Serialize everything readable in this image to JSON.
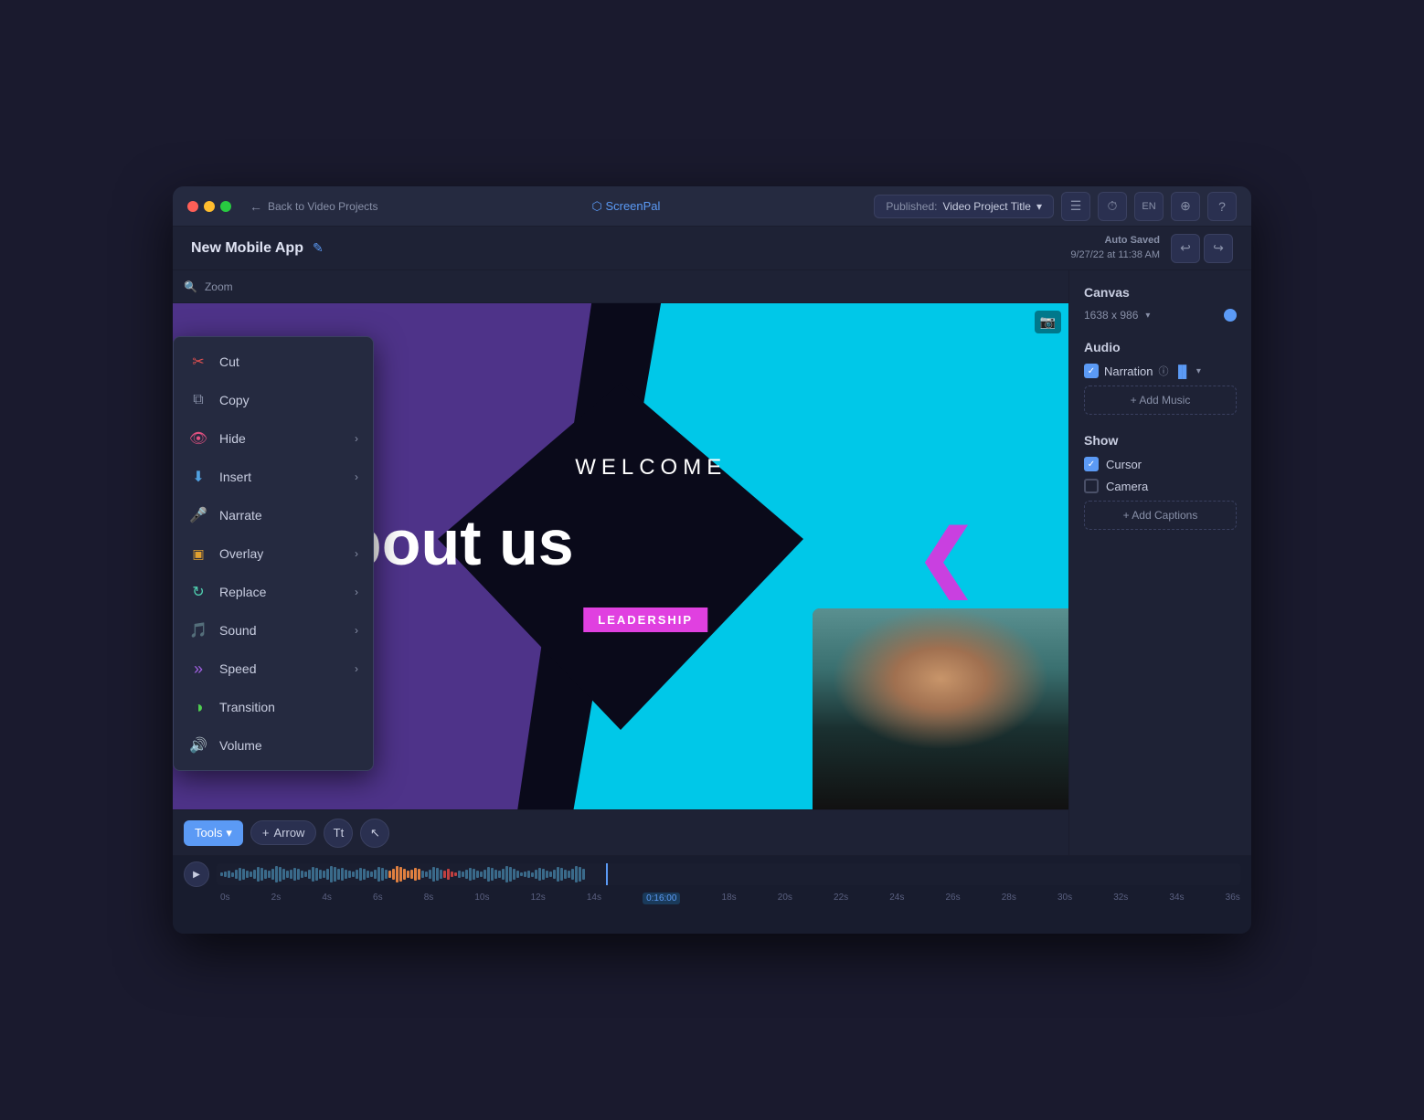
{
  "window": {
    "title": "ScreenPal",
    "logo": "⬡ ScreenPal"
  },
  "titlebar": {
    "back_label": "Back to Video Projects",
    "publish_label": "Published:",
    "project_name": "Video Project Title",
    "icons": [
      "layers",
      "clock",
      "EN",
      "stack",
      "question"
    ]
  },
  "project": {
    "title": "New Mobile App",
    "auto_save_label": "Auto Saved",
    "auto_save_date": "9/27/22 at 11:38 AM"
  },
  "toolbar_bottom": {
    "tools_label": "Tools",
    "arrow_label": "Arrow",
    "tt_label": "Tt",
    "cursor_label": "↖"
  },
  "context_menu": {
    "items": [
      {
        "id": "cut",
        "label": "Cut",
        "icon": "✂",
        "color": "#e05050",
        "has_arrow": false
      },
      {
        "id": "copy",
        "label": "Copy",
        "icon": "⧉",
        "color": "#8890a8",
        "has_arrow": false
      },
      {
        "id": "hide",
        "label": "Hide",
        "icon": "👁",
        "color": "#e05080",
        "has_arrow": true
      },
      {
        "id": "insert",
        "label": "Insert",
        "icon": "⬇",
        "color": "#50a0e0",
        "has_arrow": true
      },
      {
        "id": "narrate",
        "label": "Narrate",
        "icon": "🎤",
        "color": "#e05050",
        "has_arrow": false
      },
      {
        "id": "overlay",
        "label": "Overlay",
        "icon": "⬛",
        "color": "#e0a030",
        "has_arrow": true
      },
      {
        "id": "replace",
        "label": "Replace",
        "icon": "↻",
        "color": "#50d0b0",
        "has_arrow": true
      },
      {
        "id": "sound",
        "label": "Sound",
        "icon": "🎵",
        "color": "#e08030",
        "has_arrow": true
      },
      {
        "id": "speed",
        "label": "Speed",
        "icon": "»",
        "color": "#a060e0",
        "has_arrow": true
      },
      {
        "id": "transition",
        "label": "Transition",
        "icon": "◑",
        "color": "#50d050",
        "has_arrow": false
      },
      {
        "id": "volume",
        "label": "Volume",
        "icon": "🔊",
        "color": "#a070d0",
        "has_arrow": false
      }
    ]
  },
  "right_panel": {
    "canvas_title": "Canvas",
    "canvas_size": "1638 x 986",
    "audio_title": "Audio",
    "narration_label": "Narration",
    "add_music_label": "+ Add Music",
    "show_title": "Show",
    "cursor_label": "Cursor",
    "camera_label": "Camera",
    "add_captions_label": "+ Add Captions"
  },
  "video": {
    "welcome_text": "WELCOME",
    "about_text": "About us",
    "leadership_text": "LEADERSHIP"
  },
  "timeline": {
    "time_markers": [
      "0s",
      "2s",
      "4s",
      "6s",
      "8s",
      "10s",
      "12s",
      "14s",
      "0:16:00",
      "18s",
      "20s",
      "22s",
      "24s",
      "26s",
      "28s",
      "30s",
      "32s",
      "34s",
      "36s"
    ],
    "current_time": "0:16:00"
  }
}
